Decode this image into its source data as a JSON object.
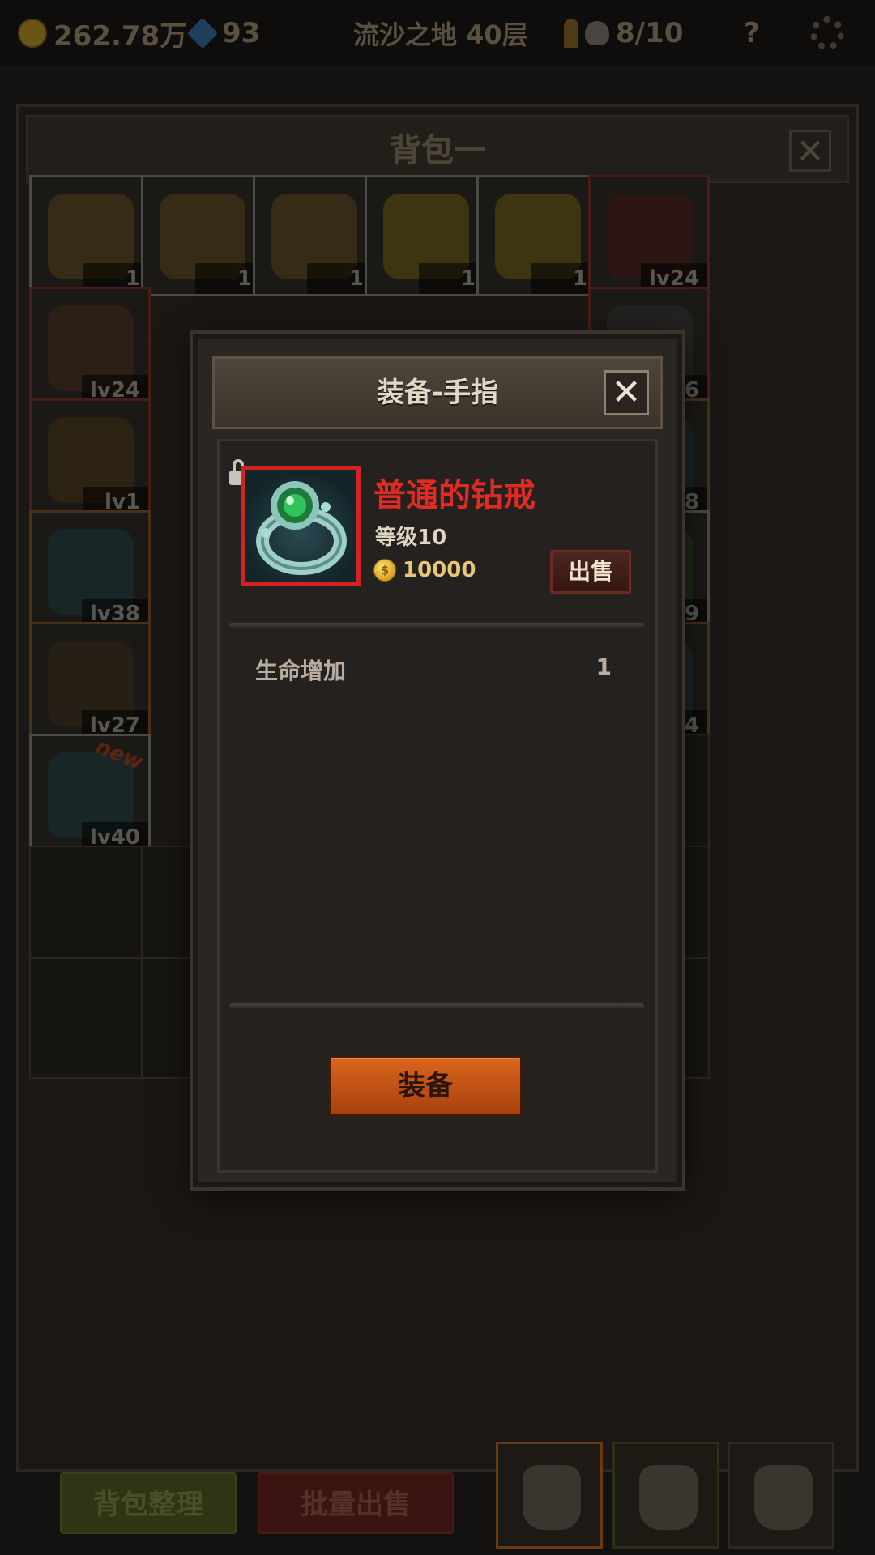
{
  "topbar": {
    "gold": "262.78万",
    "gems": "93",
    "stage": "流沙之地 40层",
    "keys_skulls": "8/10",
    "help": "?"
  },
  "backpack": {
    "title": "背包一",
    "close": "✕",
    "slots": [
      {
        "label": "1",
        "quality": "white",
        "item": "beer-mug"
      },
      {
        "label": "1",
        "quality": "white",
        "item": "beer-mug"
      },
      {
        "label": "1",
        "quality": "white",
        "item": "beer-mug"
      },
      {
        "label": "1",
        "quality": "white",
        "item": "cheese"
      },
      {
        "label": "1",
        "quality": "white",
        "item": "cheese"
      },
      {
        "label": "lv24",
        "quality": "red",
        "item": "amulet"
      },
      {
        "label": "lv24",
        "quality": "red",
        "item": "horned-helmet"
      },
      {
        "label": "lv6",
        "quality": "red",
        "item": "dark-helmet"
      },
      {
        "label": "lv1",
        "quality": "red",
        "item": "gold-ring"
      },
      {
        "label": "lv38",
        "quality": "orange",
        "item": "spear"
      },
      {
        "label": "lv38",
        "quality": "orange",
        "item": "spear"
      },
      {
        "label": "lv39",
        "quality": "white",
        "item": "green-gauntlet"
      },
      {
        "label": "lv27",
        "quality": "orange",
        "item": "shield"
      },
      {
        "label": "lv34",
        "quality": "orange",
        "item": "axe"
      },
      {
        "label": "lv40",
        "quality": "white",
        "item": "spear",
        "new": "new"
      }
    ],
    "sort_button": "背包整理",
    "bulk_sell_button": "批量出售"
  },
  "dialog": {
    "title": "装备-手指",
    "close": "✕",
    "item": {
      "name": "普通的钻戒",
      "level": "等级10",
      "price": "10000",
      "coin_symbol": "$",
      "frame_color": "#d02424",
      "name_color": "#e02a24"
    },
    "sell_button": "出售",
    "stats": [
      {
        "name": "生命增加",
        "value": "1"
      }
    ],
    "equip_button": "装备"
  }
}
